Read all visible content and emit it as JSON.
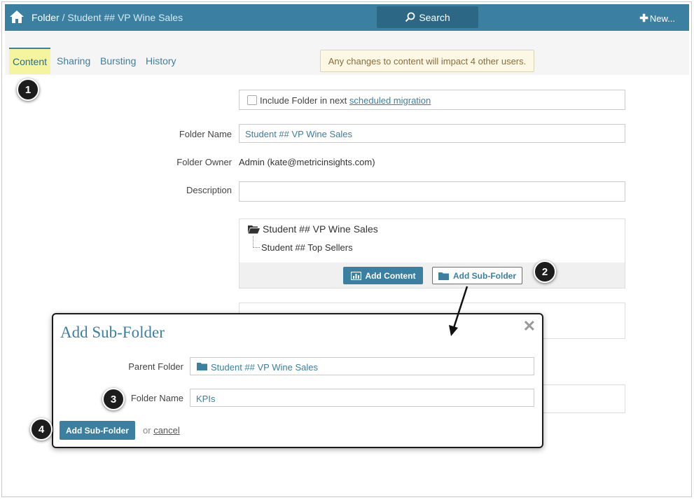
{
  "topbar": {
    "breadcrumb_root": "Folder",
    "breadcrumb_sep": "/",
    "breadcrumb_current": "Student ## VP Wine Sales",
    "search_label": "Search",
    "new_label": "New..."
  },
  "tabs": [
    "Content",
    "Sharing",
    "Bursting",
    "History"
  ],
  "notice": "Any changes to content will impact 4 other users.",
  "form": {
    "migration_text": "Include Folder in next ",
    "migration_link": "scheduled migration",
    "folder_name_label": "Folder Name",
    "folder_name_value": "Student ## VP Wine Sales",
    "folder_owner_label": "Folder Owner",
    "folder_owner_value": "Admin (kate@metricinsights.com)",
    "description_label": "Description",
    "description_value": ""
  },
  "tree": {
    "root": "Student ## VP Wine Sales",
    "child": "Student ## Top Sellers",
    "add_content_label": "Add Content",
    "add_subfolder_label": "Add Sub-Folder"
  },
  "modal": {
    "title": "Add Sub-Folder",
    "close": "✕",
    "parent_label": "Parent Folder",
    "parent_value": "Student ## VP Wine Sales",
    "name_label": "Folder Name",
    "name_value": "KPIs",
    "submit_label": "Add Sub-Folder",
    "or_text": "or",
    "cancel_label": "cancel"
  },
  "badges": [
    "1",
    "2",
    "3",
    "4"
  ],
  "colors": {
    "brand": "#3b7fa1",
    "tab_highlight": "#f5f5a0",
    "notice_bg": "#fcf8e3"
  }
}
